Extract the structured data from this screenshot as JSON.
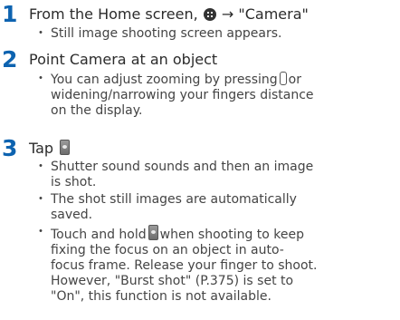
{
  "steps": [
    {
      "number": "1",
      "title_before": "From the Home screen,",
      "title_icon": "home-menu-icon",
      "title_after": "→ \"Camera\"",
      "bullets": [
        "Still image shooting screen appears."
      ]
    },
    {
      "number": "2",
      "title": "Point Camera at an object",
      "bullets": [
        {
          "before": "You can adjust zooming by pressing",
          "icon": "zoom-key-icon",
          "after": "or\nwidening/narrowing your fingers distance\non the display."
        }
      ]
    },
    {
      "number": "3",
      "title_before": "Tap",
      "title_icon": "shutter-icon",
      "bullets": [
        "Shutter sound sounds and then an image\nis shot.",
        "The shot still images are automatically\nsaved.",
        {
          "before": "Touch and hold",
          "icon": "shutter-icon",
          "after": "when shooting to keep\nfixing the focus on an object in auto-\nfocus frame. Release your finger to shoot.\nHowever, \"Burst shot\" (P.375) is set to\n\"On\", this function is not available."
        }
      ]
    }
  ],
  "bullet_glyph": "・",
  "colors": {
    "step_number": "#0d63b0",
    "text": "#3a3a3a"
  }
}
